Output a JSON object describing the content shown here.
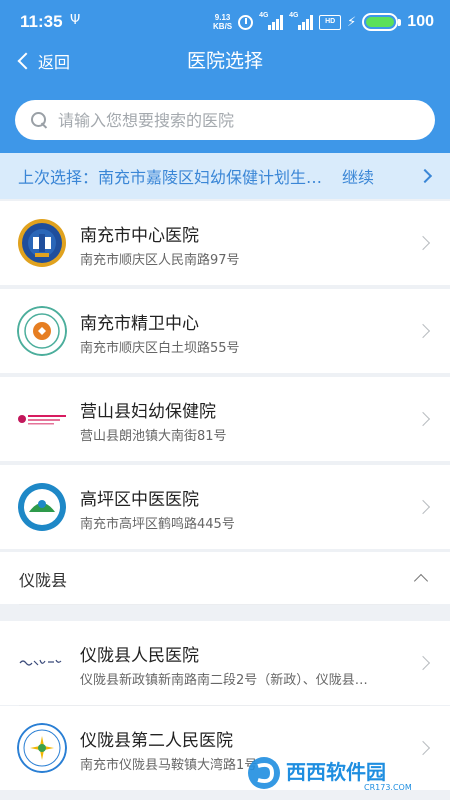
{
  "status_bar": {
    "time": "11:35",
    "usb_symbol": "Ψ",
    "net_speed_value": "9.13",
    "net_speed_unit": "KB/S",
    "signal1_tag": "4G",
    "signal2_tag": "4G",
    "hd_label": "HD",
    "battery_percent": "100"
  },
  "header": {
    "back_label": "返回",
    "title": "医院选择"
  },
  "search": {
    "placeholder": "请输入您想要搜索的医院",
    "value": ""
  },
  "last_selection": {
    "prefix": "上次选择：",
    "hospital": "南充市嘉陵区妇幼保健计划生育…",
    "continue_label": "继续"
  },
  "hospitals": [
    {
      "name": "南充市中心医院",
      "address": "南充市顺庆区人民南路97号",
      "logo": "hospital-seal-logo"
    },
    {
      "name": "南充市精卫中心",
      "address": "南充市顺庆区白土坝路55号",
      "logo": "mental-health-logo"
    },
    {
      "name": "营山县妇幼保健院",
      "address": "营山县朗池镇大南街81号",
      "logo": "maternal-child-logo"
    },
    {
      "name": "高坪区中医医院",
      "address": "南充市高坪区鹤鸣路445号",
      "logo": "tcm-hospital-logo"
    }
  ],
  "section": {
    "title": "仪陇县",
    "hospitals": [
      {
        "name": "仪陇县人民医院",
        "address": "仪陇县新政镇新南路南二段2号（新政）、仪陇县…",
        "logo": "calligraphy-logo"
      },
      {
        "name": "仪陇县第二人民医院",
        "address": "南充市仪陇县马鞍镇大湾路1号",
        "logo": "second-hospital-logo"
      }
    ]
  },
  "watermark": {
    "brand": "西西软件园",
    "url": "CR173.COM"
  },
  "colors": {
    "primary": "#3e97e8",
    "last_bar_bg": "#d9ebfb",
    "last_bar_text": "#3a86d6",
    "page_bg": "#eef1f5"
  }
}
